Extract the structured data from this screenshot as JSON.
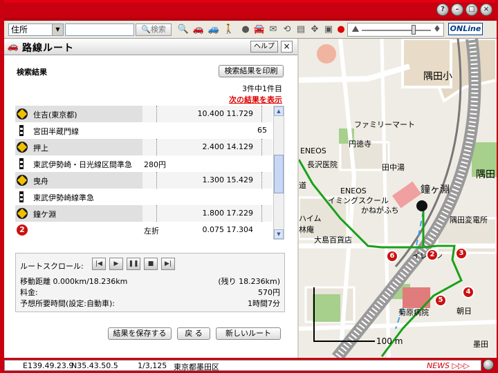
{
  "toolbar": {
    "search_type": "住所",
    "search_placeholder": "",
    "search_button": "検索",
    "logo": "ONLine"
  },
  "panel": {
    "title": "路線ルート",
    "help_label": "ヘルプ",
    "close_label": "×",
    "result_heading": "検索結果",
    "print_button": "検索結果を印刷",
    "result_count": "3件中1件目",
    "next_result": "次の結果を表示"
  },
  "route_rows": [
    {
      "type": "station",
      "name": "住吉(東京都)",
      "fare": "",
      "dist": "10.400",
      "cum": "11.729",
      "extra": ""
    },
    {
      "type": "train",
      "name": "宮田半蔵門線",
      "fare": "",
      "dist": "",
      "cum": "",
      "extra": "65"
    },
    {
      "type": "station",
      "name": "押上",
      "fare": "",
      "dist": "2.400",
      "cum": "14.129",
      "extra": ""
    },
    {
      "type": "train",
      "name": "東武伊勢崎・日光線区間準急",
      "fare": "280円",
      "dist": "",
      "cum": "",
      "extra": ""
    },
    {
      "type": "station",
      "name": "曳舟",
      "fare": "",
      "dist": "1.300",
      "cum": "15.429",
      "extra": ""
    },
    {
      "type": "train",
      "name": "東武伊勢崎線準急",
      "fare": "",
      "dist": "",
      "cum": "",
      "extra": ""
    },
    {
      "type": "station",
      "name": "鐘ケ淵",
      "fare": "",
      "dist": "1.800",
      "cum": "17.229",
      "extra": ""
    },
    {
      "type": "num",
      "num": "2",
      "name": "",
      "fare": "左折",
      "dist": "0.075",
      "cum": "17.304",
      "extra": ""
    }
  ],
  "controls": {
    "scroll_label": "ルートスクロール:",
    "moved_label": "移動距離",
    "moved_value": "0.000km/18.236km",
    "remaining": "(残り 18.236km)",
    "fare_label": "料金:",
    "fare_value": "570円",
    "time_label": "予想所要時間(設定:自動車):",
    "time_value": "1時間7分"
  },
  "buttons": {
    "save": "結果を保存する",
    "back": "戻 る",
    "new_route": "新しいルート"
  },
  "map": {
    "labels": {
      "sumida_school": "隅田小",
      "family_mart": "ファミリーマート",
      "entokuji": "円徳寺",
      "nagasawa": "長沢医院",
      "eneos1": "ENEOS",
      "eneos2": "ENEOS",
      "tanaka": "田中湯",
      "swimming": "イミングスクール",
      "kanegafuchi": "かねがふち",
      "kanegafuchi_station": "鐘ヶ淵",
      "sumida_substation": "隅田変電所",
      "haim": "ハイム",
      "rinan": "林庵",
      "ohshima": "大島百貨店",
      "irekon": "イレヨン",
      "kikuhara": "菊原病院",
      "asahi": "朝日",
      "sumida_right": "隅田",
      "dou": "道",
      "scale": "100 m",
      "bottom_right": "墨田"
    },
    "markers": [
      "6",
      "2",
      "3",
      "5",
      "4"
    ],
    "route_color": "#1aa01a"
  },
  "status": {
    "coords_e": "E139.49.23.9",
    "coords_n": "N35.43.50.5",
    "scale": "1/3,125",
    "area": "東京都墨田区",
    "news": "NEWS ▷▷▷"
  }
}
